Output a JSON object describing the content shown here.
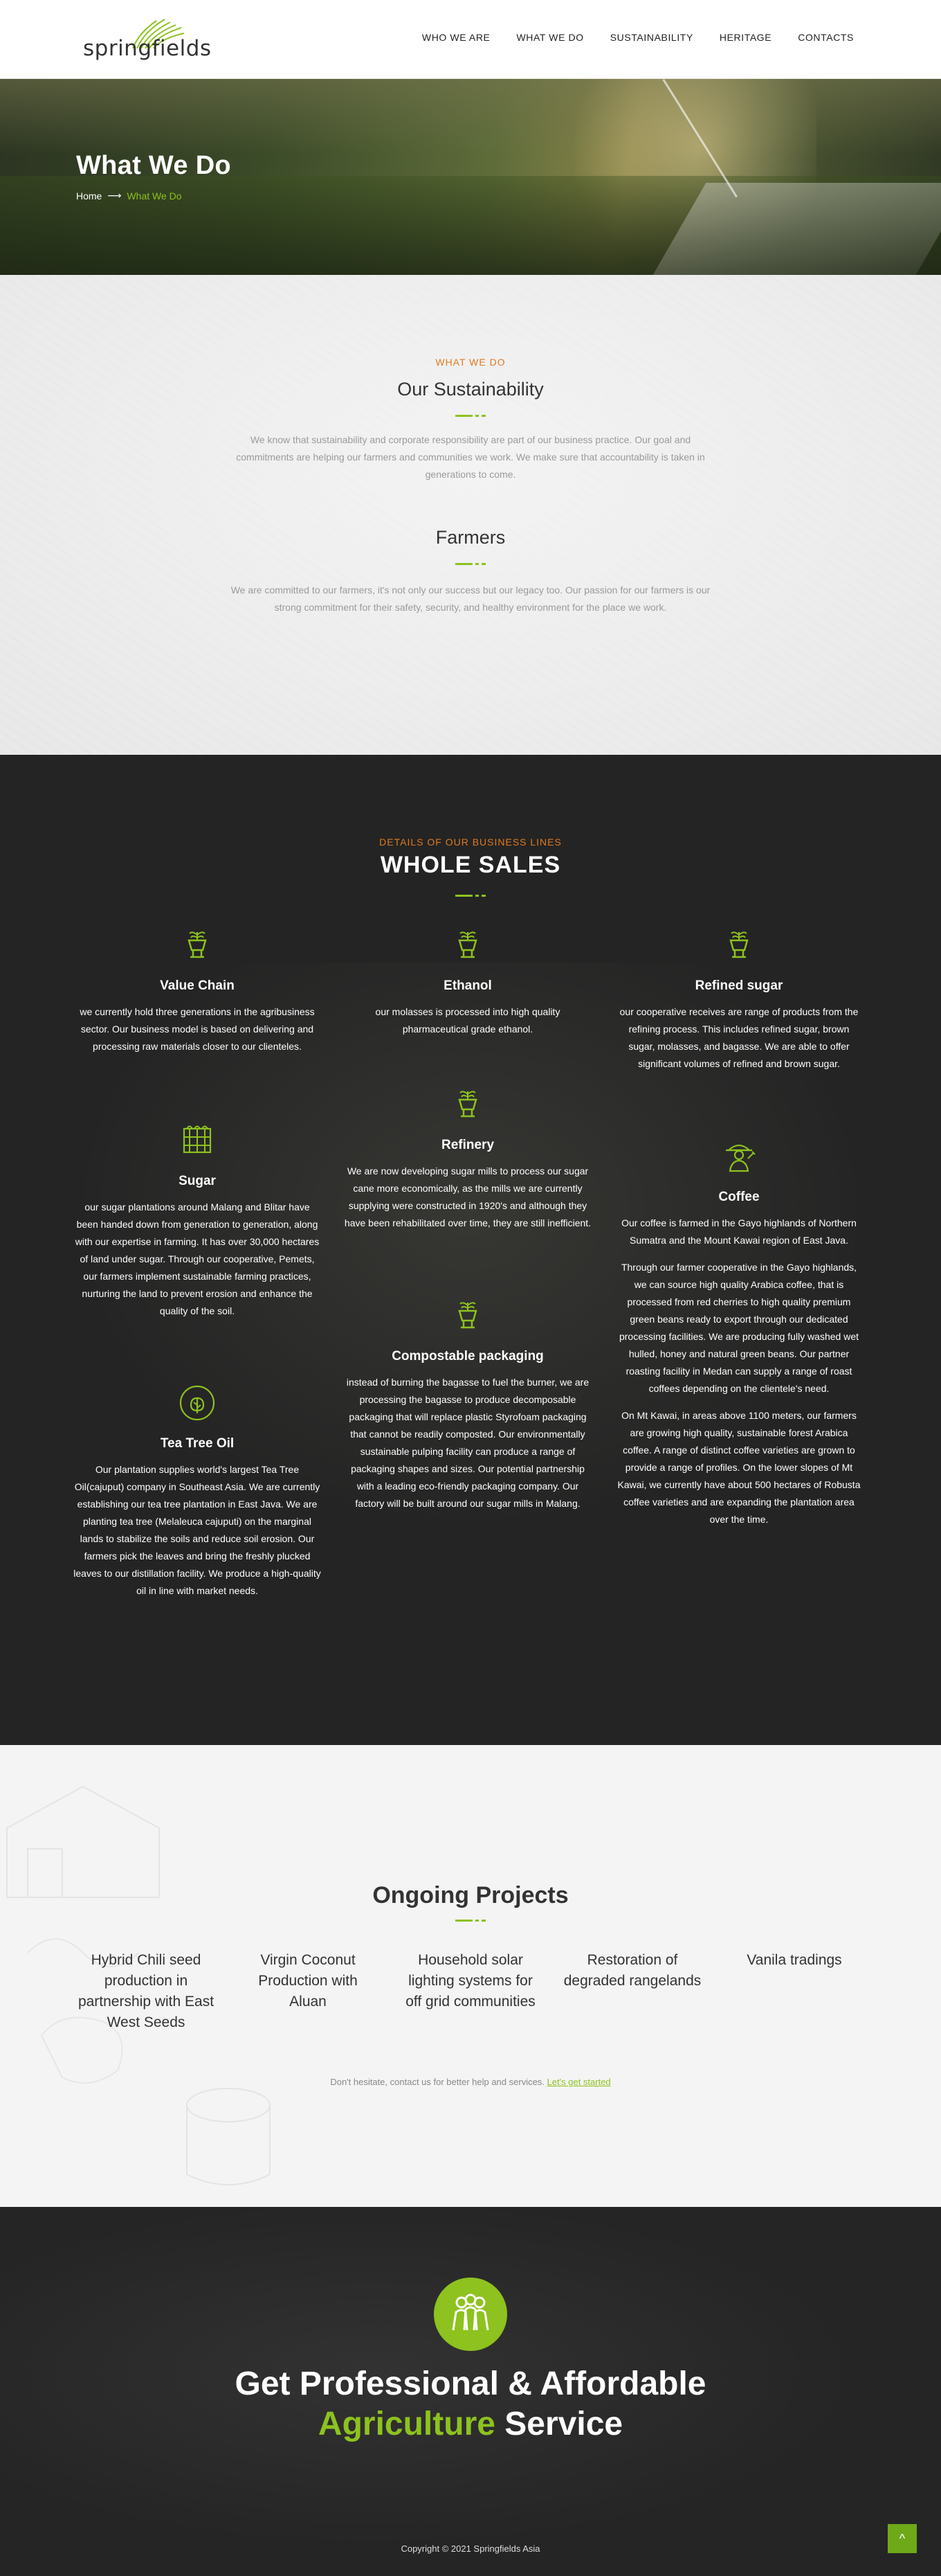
{
  "brand": {
    "logo_text": "springfields",
    "accent": "#8dc21f",
    "eyebrow_color": "#e07a1f"
  },
  "nav": [
    {
      "label": "WHO WE ARE"
    },
    {
      "label": "WHAT WE DO"
    },
    {
      "label": "SUSTAINABILITY"
    },
    {
      "label": "HERITAGE"
    },
    {
      "label": "CONTACTS"
    }
  ],
  "hero": {
    "title": "What We Do",
    "breadcrumb": {
      "home": "Home",
      "arrow": "⟶",
      "current": "What We Do"
    }
  },
  "what_we_do": {
    "eyebrow": "WHAT WE DO",
    "title": "Our Sustainability",
    "body": "We know that sustainability and corporate responsibility are part of our business practice. Our goal and commitments are helping our farmers and communities we work. We make sure that accountability is taken in generations to come.",
    "farmers_title": "Farmers",
    "farmers_body": "We are committed to our farmers, it's not only our success but our legacy too. Our passion for our farmers is our strong commitment for their safety, security, and healthy environment for the place we work."
  },
  "whole_sales": {
    "eyebrow": "DETAILS OF OUR BUSINESS LINES",
    "title": "WHOLE SALES",
    "cards": [
      {
        "icon": "plant-cup-icon",
        "title": "Value Chain",
        "paragraphs": [
          "we currently hold three generations in the agribusiness sector. Our business model is based on delivering and processing raw materials closer to our clienteles."
        ]
      },
      {
        "icon": "plant-cup-icon",
        "title": "Ethanol",
        "paragraphs": [
          "our molasses is processed into high quality pharmaceutical grade ethanol."
        ]
      },
      {
        "icon": "plant-cup-icon",
        "title": "Refined sugar",
        "paragraphs": [
          "our cooperative receives are range of products from the refining process. This includes refined sugar, brown sugar, molasses, and bagasse. We are able to offer significant volumes of refined and brown sugar."
        ]
      },
      {
        "icon": "sugarcane-icon",
        "title": "Sugar",
        "paragraphs": [
          "our sugar plantations around Malang and Blitar have been handed down from generation to generation, along with our expertise in farming. It has over 30,000 hectares of land under sugar. Through our cooperative, Pemets, our farmers implement sustainable farming practices, nurturing the land to prevent erosion and enhance the quality of the soil."
        ]
      },
      {
        "icon": "plant-cup-icon",
        "title": "Refinery",
        "paragraphs": [
          "We are now developing sugar mills to process our sugar cane more economically, as the mills we are currently supplying were constructed in 1920's and although they have been rehabilitated over time, they are still inefficient."
        ]
      },
      {
        "icon": "farmer-icon",
        "title": "Coffee",
        "paragraphs": [
          "Our coffee is farmed in the Gayo highlands of Northern Sumatra and the Mount Kawai region of East Java.",
          "Through our farmer cooperative in the Gayo highlands, we can source high quality Arabica coffee, that is processed from red cherries to high quality premium green beans ready to export through our dedicated processing facilities. We are producing fully washed wet hulled, honey and natural green beans. Our partner roasting facility in Medan can supply a range of roast coffees depending on the clientele's need.",
          "On Mt Kawai, in areas above 1100 meters, our farmers are growing high quality, sustainable forest Arabica coffee. A range of distinct coffee varieties are grown to provide a range of profiles. On the lower slopes of Mt Kawai, we currently have about 500 hectares of Robusta coffee varieties and are expanding the plantation area over the time."
        ]
      },
      {
        "icon": "plant-cup-icon",
        "title": "Compostable packaging",
        "paragraphs": [
          "instead of burning the bagasse to fuel the burner, we are processing the bagasse to produce decomposable packaging that will replace plastic Styrofoam packaging that cannot be readily composted. Our environmentally sustainable pulping facility can produce a range of packaging shapes and sizes. Our potential partnership with a leading eco-friendly packaging company. Our factory will be built around our sugar mills in Malang."
        ]
      },
      {
        "icon": "leaf-circle-icon",
        "title": "Tea Tree Oil",
        "paragraphs": [
          "Our plantation supplies world's largest Tea Tree Oil(cajuput) company in Southeast Asia. We are currently establishing our tea tree plantation in East Java. We are planting tea tree (Melaleuca cajuputi) on the marginal lands to stabilize the soils and reduce soil erosion. Our farmers pick the leaves and bring the freshly plucked leaves to our distillation facility. We produce a high-quality oil in line with market needs."
        ]
      }
    ]
  },
  "ongoing": {
    "title": "Ongoing Projects",
    "projects": [
      "Hybrid Chili seed production in partnership with East West Seeds",
      "Virgin Coconut Production with Aluan",
      "Household solar lighting systems for off grid communities",
      "Restoration of degraded rangelands",
      "Vanila tradings"
    ],
    "cta_text": "Don't hesitate, contact us for better help and services.",
    "cta_link": "Let's get started"
  },
  "footer": {
    "line1": "Get Professional & Affordable",
    "line2_accent": "Agriculture",
    "line2_rest": " Service",
    "copyright": "Copyright © 2021 Springfields Asia",
    "to_top": "^"
  }
}
